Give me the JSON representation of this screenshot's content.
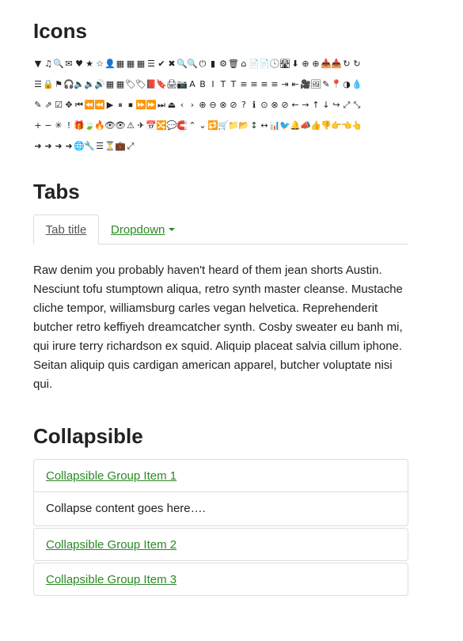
{
  "sections": {
    "icons_title": "Icons",
    "tabs_title": "Tabs",
    "collapsible_title": "Collapsible"
  },
  "icons": {
    "rows": [
      [
        "▼",
        "♫",
        "🔍",
        "✉",
        "♥",
        "★",
        "☆",
        "👤",
        "▦",
        "▦",
        "▦",
        "☰",
        "✔",
        "✖",
        "🔍",
        "🔍",
        "⏻",
        "▮",
        "⚙",
        "🗑",
        "⌂",
        "📄",
        "📄",
        "🕓",
        "🛣",
        "⬇",
        "⊕",
        "⊕",
        "📥",
        "📥",
        "↻",
        "↻"
      ],
      [
        "☰",
        "🔒",
        "⚑",
        "🎧",
        "🔈",
        "🔉",
        "🔊",
        "▦",
        "▦",
        "🏷",
        "🏷",
        "📕",
        "🔖",
        "🖨",
        "📷",
        "A",
        "B",
        "I",
        "T",
        "T",
        "≡",
        "≡",
        "≡",
        "≡",
        "⇥",
        "⇤",
        "🎥",
        "🖼",
        "✎",
        "📍",
        "◑",
        "💧"
      ],
      [
        "✎",
        "⇗",
        "☑",
        "✥",
        "⏮",
        "⏪",
        "⏪",
        "▶",
        "⏸",
        "⏹",
        "⏩",
        "⏩",
        "⏭",
        "⏏",
        "‹",
        "›",
        "⊕",
        "⊖",
        "⊗",
        "⊘",
        "?",
        "ℹ",
        "⊙",
        "⊗",
        "⊘",
        "←",
        "→",
        "↑",
        "↓",
        "↪",
        "⤢",
        "⤡"
      ],
      [
        "+",
        "−",
        "✳",
        "!",
        "🎁",
        "🍃",
        "🔥",
        "👁",
        "👁",
        "⚠",
        "✈",
        "📅",
        "🔀",
        "💬",
        "🧲",
        "⌃",
        "⌄",
        "🔁",
        "🛒",
        "📁",
        "📂",
        "↕",
        "↔",
        "📊",
        "🐦",
        "🔔",
        "📣",
        "👍",
        "👎",
        "👉",
        "👈",
        "👆"
      ],
      [
        "➜",
        "➜",
        "➜",
        "➜",
        "🌐",
        "🔧",
        "☰",
        "⏳",
        "💼",
        "⤢"
      ]
    ]
  },
  "tabs": {
    "active_label": "Tab title",
    "dropdown_label": "Dropdown",
    "content": "Raw denim you probably haven't heard of them jean shorts Austin. Nesciunt tofu stumptown aliqua, retro synth master cleanse. Mustache cliche tempor, williamsburg carles vegan helvetica. Reprehenderit butcher retro keffiyeh dreamcatcher synth. Cosby sweater eu banh mi, qui irure terry richardson ex squid. Aliquip placeat salvia cillum iphone. Seitan aliquip quis cardigan american apparel, butcher voluptate nisi qui."
  },
  "collapsible": {
    "items": [
      {
        "title": "Collapsible Group Item 1",
        "body": "Collapse content goes here…."
      },
      {
        "title": "Collapsible Group Item 2"
      },
      {
        "title": "Collapsible Group Item 3"
      }
    ]
  },
  "colors": {
    "link": "#2a8a23",
    "text": "#222222",
    "border": "#dddddd",
    "muted_tab": "#555555"
  }
}
